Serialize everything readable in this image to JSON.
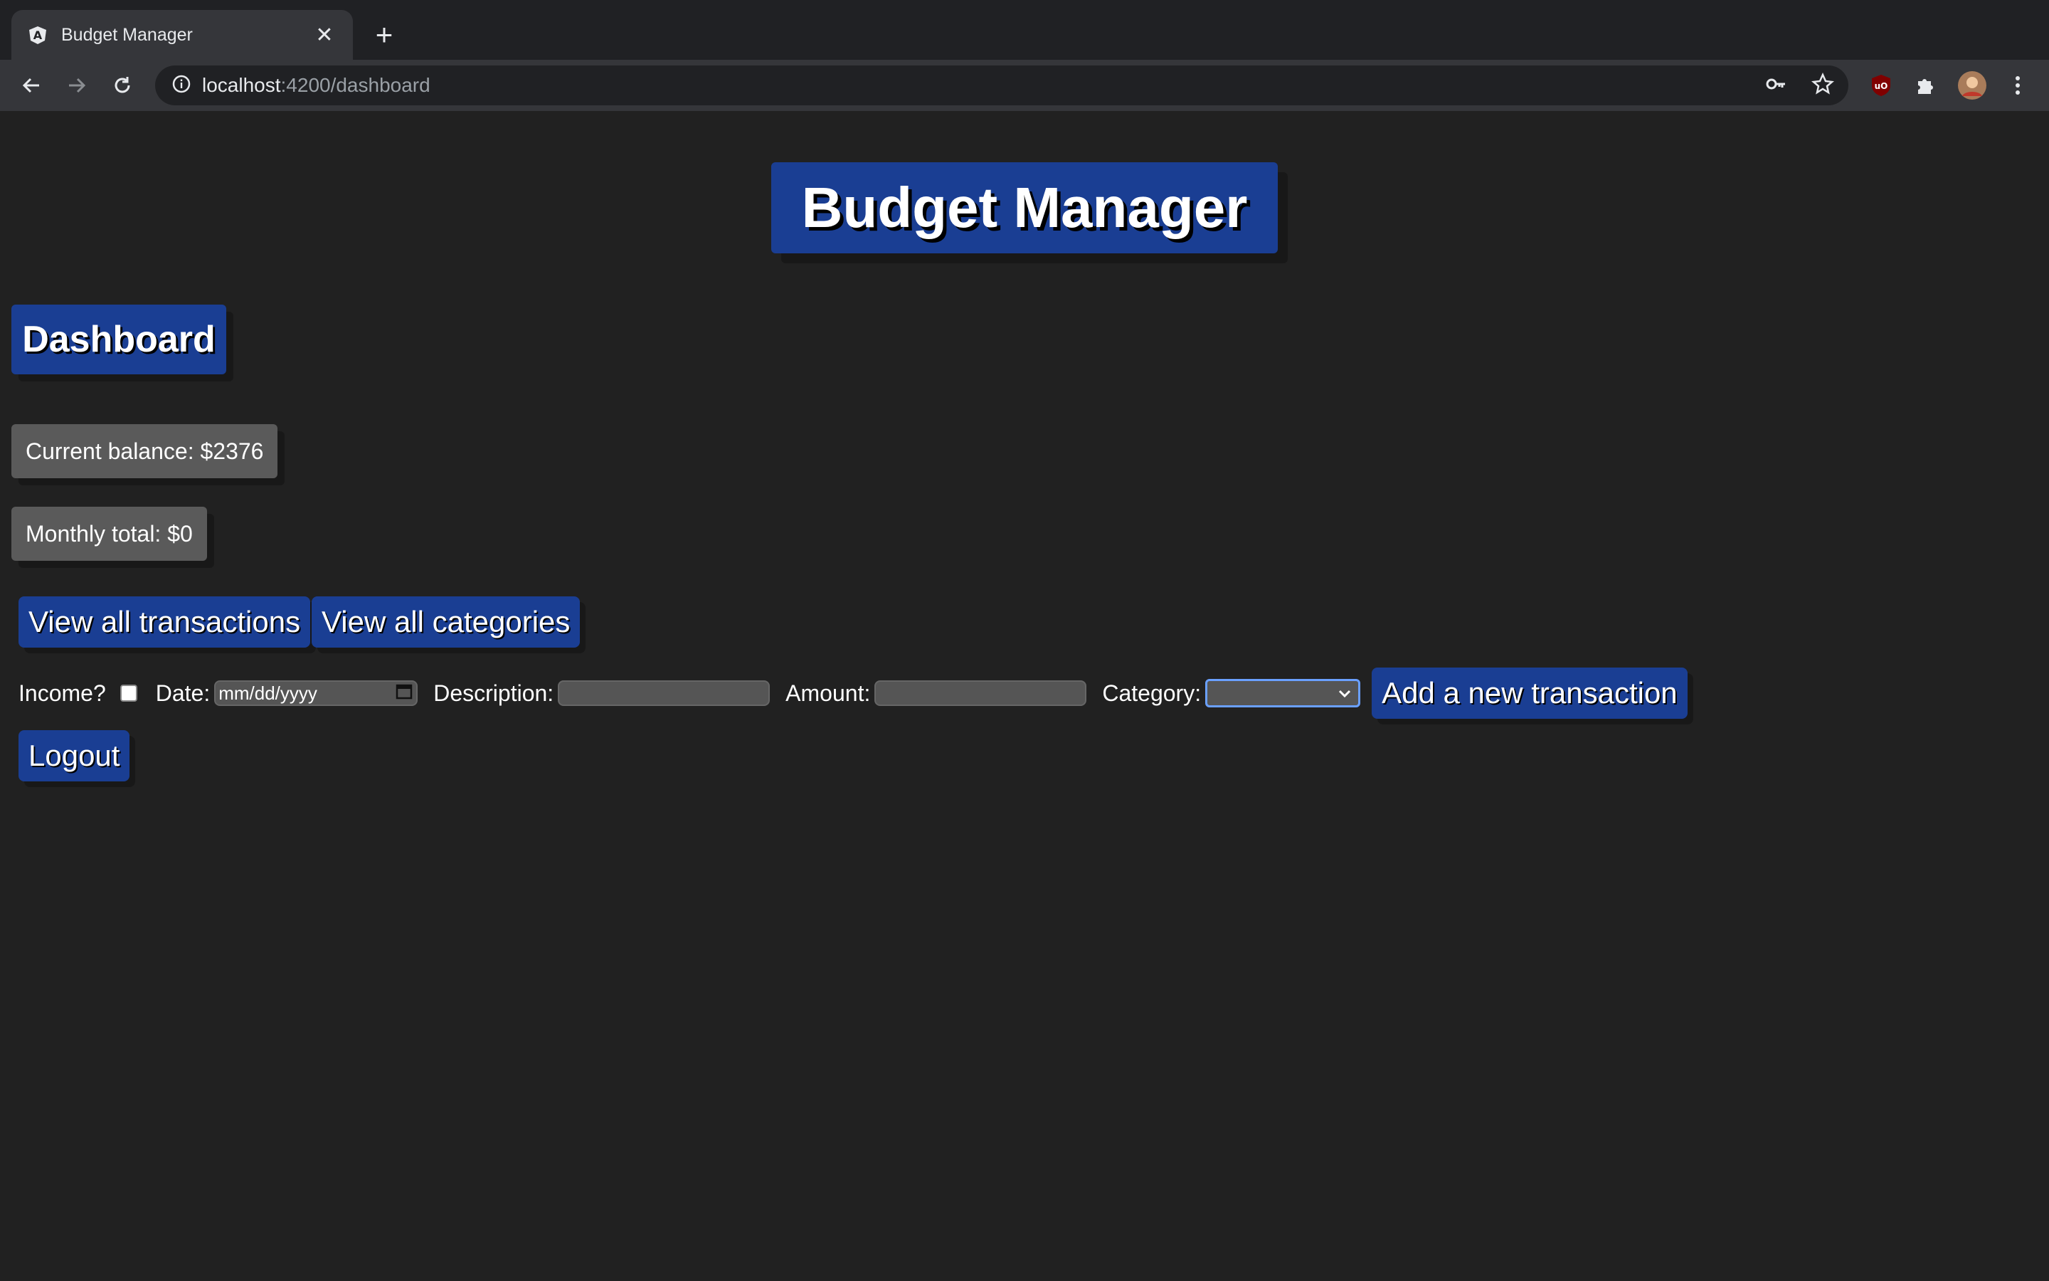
{
  "browser": {
    "tab_title": "Budget Manager",
    "tab_close": "✕",
    "new_tab": "+",
    "url_host": "localhost",
    "url_path": ":4200/dashboard"
  },
  "page": {
    "app_title": "Budget Manager",
    "section_title": "Dashboard",
    "current_balance": "Current balance: $2376",
    "monthly_total": "Monthly total: $0",
    "view_transactions_label": "View all transactions",
    "view_categories_label": "View all categories",
    "form": {
      "income_label": "Income?",
      "date_label": "Date:",
      "date_placeholder": "mm/dd/yyyy",
      "description_label": "Description:",
      "amount_label": "Amount:",
      "category_label": "Category:",
      "add_label": "Add a new transaction"
    },
    "logout_label": "Logout"
  },
  "colors": {
    "accent": "#1a3e93",
    "background": "#212121",
    "stat_bg": "#5a5a5a"
  }
}
